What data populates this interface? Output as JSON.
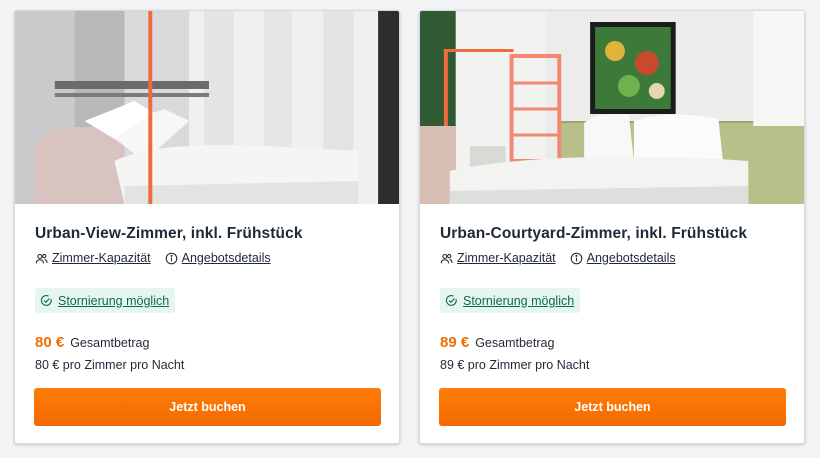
{
  "rooms": [
    {
      "title": "Urban-View-Zimmer, inkl. Frühstück",
      "capacity_link": "Zimmer-Kapazität",
      "details_link": "Angebotsdetails",
      "cancellation": "Stornierung möglich",
      "price": "80 €",
      "price_label": "Gesamtbetrag",
      "per_night": "80 € pro Zimmer pro Nacht",
      "book_label": "Jetzt buchen"
    },
    {
      "title": "Urban-Courtyard-Zimmer, inkl. Frühstück",
      "capacity_link": "Zimmer-Kapazität",
      "details_link": "Angebotsdetails",
      "cancellation": "Stornierung möglich",
      "price": "89 €",
      "price_label": "Gesamtbetrag",
      "per_night": "89 € pro Zimmer pro Nacht",
      "book_label": "Jetzt buchen"
    }
  ],
  "icons": {
    "capacity": "people-icon",
    "details": "info-circle-icon",
    "cancellation": "check-circle-icon"
  },
  "colors": {
    "accent": "#f26a00",
    "price": "#f06e00",
    "cancellation_bg": "#e6f6ef",
    "cancellation_text": "#0d6b4a"
  }
}
